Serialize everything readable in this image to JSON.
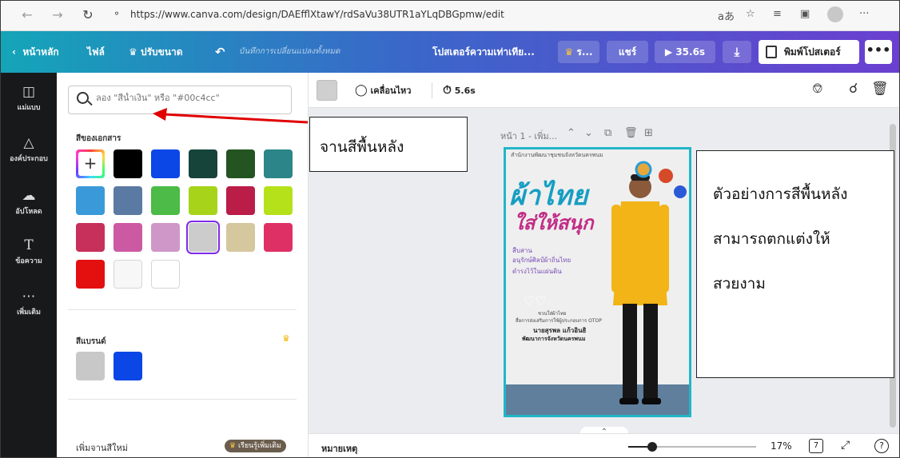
{
  "browser": {
    "url": "https://www.canva.com/design/DAEfflXtawY/rdSaVu38UTR1aYLqDBGpmw/edit",
    "read_aloud": "aあ",
    "icons": [
      "back-icon",
      "forward-icon",
      "reload-icon",
      "lock-icon",
      "favorite-icon",
      "collections-icon",
      "profile-icon",
      "more-icon"
    ],
    "more": "···"
  },
  "header": {
    "home": "หน้าหลัก",
    "file": "ไฟล์",
    "resize": "ปรับขนาด",
    "save_status": "บันทึกการเปลี่ยนแปลงทั้งหมด",
    "design_title": "โปสเตอร์ความเท่าเทีย...",
    "crown_button": "ร...",
    "share": "แชร์",
    "play_duration": "35.6s",
    "print": "พิมพ์โปสเตอร์",
    "more": "•••"
  },
  "sidebar": {
    "items": [
      {
        "label": "แม่แบบ",
        "icon": "template-icon"
      },
      {
        "label": "องค์ประกอบ",
        "icon": "elements-icon"
      },
      {
        "label": "อัปโหลด",
        "icon": "upload-icon"
      },
      {
        "label": "ข้อความ",
        "icon": "text-icon"
      },
      {
        "label": "เพิ่มเติม",
        "icon": "more-icon"
      }
    ]
  },
  "panel": {
    "search_placeholder": "ลอง \"สีน้ำเงิน\" หรือ \"#00c4cc\"",
    "document_colors_title": "สีของเอกสาร",
    "brand_colors_title": "สีแบรนด์",
    "new_palette": "เพิ่มจานสีใหม่",
    "learn_more": "เรียนรู้เพิ่มเติม",
    "document_colors": [
      "#000000",
      "#0b47e6",
      "#17443a",
      "#245421",
      "#2c8588",
      "#3a9ad9",
      "#5a7aa3",
      "#4cbb47",
      "#a7d41a",
      "#b91d48",
      "#b5e11a",
      "#c7305a",
      "#cc5aa3",
      "#cf97c8",
      "#cccccc",
      "#d5c79e",
      "#df3066",
      "#e40f0f",
      "#f7f7f7",
      "#ffffff"
    ],
    "selected_color": "#cccccc",
    "brand_colors": [
      "#c8c8c8",
      "#0b47e6"
    ]
  },
  "toolbar": {
    "animate": "เคลื่อนไหว",
    "duration": "5.6s"
  },
  "page": {
    "label": "หน้า 1 - เพิ่ม..."
  },
  "design": {
    "top_text": "สำนักงานพัฒนาชุมชนจังหวัดนครพนม",
    "title1": "ผ้าไทย",
    "title2": "ใส่ให้สนุก",
    "line1": "สืบสาน",
    "line2": "อนุรักษ์ศิลป์ผ้าถิ่นไทย",
    "line3": "ดำรงไว้ในแผ่นดิน",
    "small1": "ชวนใส่ผ้าไทย",
    "small2": "สื่อการส่งเสริมการใช้ผู้ประกอบการ OTOP",
    "name": "นายสุรพล แก้วอินธิ",
    "position": "พัฒนาการจังหวัดนครพนม"
  },
  "footer": {
    "notes": "หมายเหตุ",
    "zoom": "17%",
    "zoom_fraction": 0.17,
    "pages": "7"
  },
  "annotations": {
    "palette_label": "จานสีพื้นหลัง",
    "example_line1": "ตัวอย่างการสีพื้นหลัง",
    "example_line2": "สามารถตกแต่งให้",
    "example_line3": "สวยงาม",
    "arrow_color": "#e00000"
  }
}
